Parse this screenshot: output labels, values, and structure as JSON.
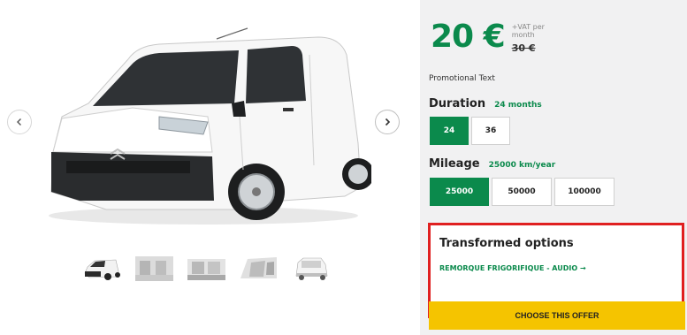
{
  "gallery": {
    "prev_icon": "chevron-left-icon",
    "next_icon": "chevron-right-icon",
    "thumbnails": [
      "exterior-front",
      "interior-seats",
      "interior-side",
      "interior-cargo",
      "exterior-rear"
    ]
  },
  "offer": {
    "price": "20 €",
    "vat_note": "+VAT per month",
    "old_price": "30 €",
    "promo_text": "Promotional Text",
    "duration": {
      "label": "Duration",
      "selected_text": "24 months",
      "options": [
        "24",
        "36"
      ],
      "selected_index": 0
    },
    "mileage": {
      "label": "Mileage",
      "selected_text": "25000 km/year",
      "options": [
        "25000",
        "50000",
        "100000"
      ],
      "selected_index": 0
    },
    "transformed": {
      "title": "Transformed options",
      "link": "REMORQUE FRIGORIFIQUE - AUDIO →"
    },
    "cta_label": "CHOOSE THIS OFFER"
  },
  "colors": {
    "brand_green": "#0b8a4c",
    "cta_yellow": "#f5c400",
    "highlight_red": "#e02020",
    "panel_bg": "#f1f1f2"
  }
}
